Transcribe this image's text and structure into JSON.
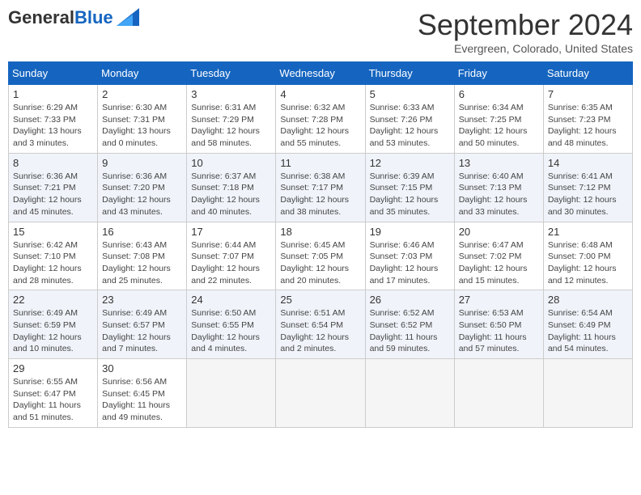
{
  "header": {
    "logo_line1": "General",
    "logo_line2": "Blue",
    "month": "September 2024",
    "location": "Evergreen, Colorado, United States"
  },
  "weekdays": [
    "Sunday",
    "Monday",
    "Tuesday",
    "Wednesday",
    "Thursday",
    "Friday",
    "Saturday"
  ],
  "weeks": [
    [
      {
        "day": "1",
        "info": "Sunrise: 6:29 AM\nSunset: 7:33 PM\nDaylight: 13 hours\nand 3 minutes."
      },
      {
        "day": "2",
        "info": "Sunrise: 6:30 AM\nSunset: 7:31 PM\nDaylight: 13 hours\nand 0 minutes."
      },
      {
        "day": "3",
        "info": "Sunrise: 6:31 AM\nSunset: 7:29 PM\nDaylight: 12 hours\nand 58 minutes."
      },
      {
        "day": "4",
        "info": "Sunrise: 6:32 AM\nSunset: 7:28 PM\nDaylight: 12 hours\nand 55 minutes."
      },
      {
        "day": "5",
        "info": "Sunrise: 6:33 AM\nSunset: 7:26 PM\nDaylight: 12 hours\nand 53 minutes."
      },
      {
        "day": "6",
        "info": "Sunrise: 6:34 AM\nSunset: 7:25 PM\nDaylight: 12 hours\nand 50 minutes."
      },
      {
        "day": "7",
        "info": "Sunrise: 6:35 AM\nSunset: 7:23 PM\nDaylight: 12 hours\nand 48 minutes."
      }
    ],
    [
      {
        "day": "8",
        "info": "Sunrise: 6:36 AM\nSunset: 7:21 PM\nDaylight: 12 hours\nand 45 minutes."
      },
      {
        "day": "9",
        "info": "Sunrise: 6:36 AM\nSunset: 7:20 PM\nDaylight: 12 hours\nand 43 minutes."
      },
      {
        "day": "10",
        "info": "Sunrise: 6:37 AM\nSunset: 7:18 PM\nDaylight: 12 hours\nand 40 minutes."
      },
      {
        "day": "11",
        "info": "Sunrise: 6:38 AM\nSunset: 7:17 PM\nDaylight: 12 hours\nand 38 minutes."
      },
      {
        "day": "12",
        "info": "Sunrise: 6:39 AM\nSunset: 7:15 PM\nDaylight: 12 hours\nand 35 minutes."
      },
      {
        "day": "13",
        "info": "Sunrise: 6:40 AM\nSunset: 7:13 PM\nDaylight: 12 hours\nand 33 minutes."
      },
      {
        "day": "14",
        "info": "Sunrise: 6:41 AM\nSunset: 7:12 PM\nDaylight: 12 hours\nand 30 minutes."
      }
    ],
    [
      {
        "day": "15",
        "info": "Sunrise: 6:42 AM\nSunset: 7:10 PM\nDaylight: 12 hours\nand 28 minutes."
      },
      {
        "day": "16",
        "info": "Sunrise: 6:43 AM\nSunset: 7:08 PM\nDaylight: 12 hours\nand 25 minutes."
      },
      {
        "day": "17",
        "info": "Sunrise: 6:44 AM\nSunset: 7:07 PM\nDaylight: 12 hours\nand 22 minutes."
      },
      {
        "day": "18",
        "info": "Sunrise: 6:45 AM\nSunset: 7:05 PM\nDaylight: 12 hours\nand 20 minutes."
      },
      {
        "day": "19",
        "info": "Sunrise: 6:46 AM\nSunset: 7:03 PM\nDaylight: 12 hours\nand 17 minutes."
      },
      {
        "day": "20",
        "info": "Sunrise: 6:47 AM\nSunset: 7:02 PM\nDaylight: 12 hours\nand 15 minutes."
      },
      {
        "day": "21",
        "info": "Sunrise: 6:48 AM\nSunset: 7:00 PM\nDaylight: 12 hours\nand 12 minutes."
      }
    ],
    [
      {
        "day": "22",
        "info": "Sunrise: 6:49 AM\nSunset: 6:59 PM\nDaylight: 12 hours\nand 10 minutes."
      },
      {
        "day": "23",
        "info": "Sunrise: 6:49 AM\nSunset: 6:57 PM\nDaylight: 12 hours\nand 7 minutes."
      },
      {
        "day": "24",
        "info": "Sunrise: 6:50 AM\nSunset: 6:55 PM\nDaylight: 12 hours\nand 4 minutes."
      },
      {
        "day": "25",
        "info": "Sunrise: 6:51 AM\nSunset: 6:54 PM\nDaylight: 12 hours\nand 2 minutes."
      },
      {
        "day": "26",
        "info": "Sunrise: 6:52 AM\nSunset: 6:52 PM\nDaylight: 11 hours\nand 59 minutes."
      },
      {
        "day": "27",
        "info": "Sunrise: 6:53 AM\nSunset: 6:50 PM\nDaylight: 11 hours\nand 57 minutes."
      },
      {
        "day": "28",
        "info": "Sunrise: 6:54 AM\nSunset: 6:49 PM\nDaylight: 11 hours\nand 54 minutes."
      }
    ],
    [
      {
        "day": "29",
        "info": "Sunrise: 6:55 AM\nSunset: 6:47 PM\nDaylight: 11 hours\nand 51 minutes."
      },
      {
        "day": "30",
        "info": "Sunrise: 6:56 AM\nSunset: 6:45 PM\nDaylight: 11 hours\nand 49 minutes."
      },
      {
        "day": "",
        "info": ""
      },
      {
        "day": "",
        "info": ""
      },
      {
        "day": "",
        "info": ""
      },
      {
        "day": "",
        "info": ""
      },
      {
        "day": "",
        "info": ""
      }
    ]
  ]
}
